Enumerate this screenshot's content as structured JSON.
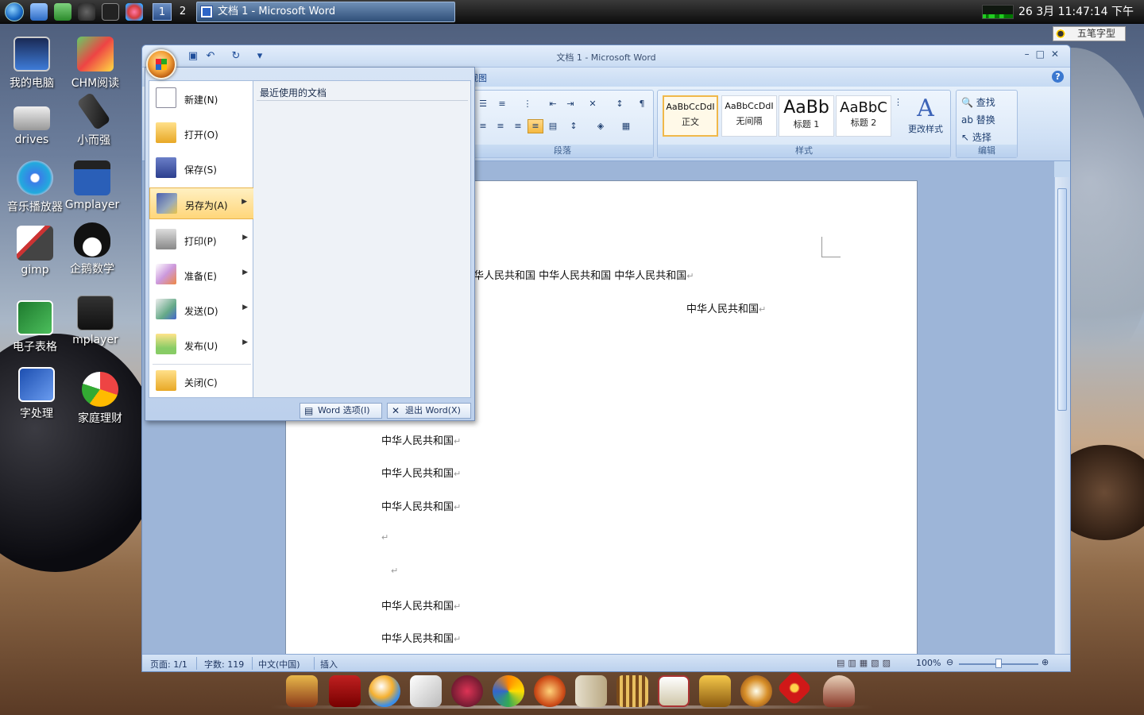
{
  "top_panel": {
    "workspaces": [
      "1",
      "2"
    ],
    "task_title": "文档 1 - Microsoft Word",
    "clock": "26  3月 11:47:14 下午",
    "ime": "五笔字型"
  },
  "desktop_icons": [
    {
      "label": "我的电脑",
      "icon": "computer-icon"
    },
    {
      "label": "CHM阅读",
      "icon": "chm-reader-icon"
    },
    {
      "label": "drives",
      "icon": "drive-icon"
    },
    {
      "label": "小而强",
      "icon": "usb-stick-icon"
    },
    {
      "label": "音乐播放器",
      "icon": "music-player-icon"
    },
    {
      "label": "Gmplayer",
      "icon": "gmplayer-icon"
    },
    {
      "label": "gimp",
      "icon": "gimp-icon"
    },
    {
      "label": "企鹅数学",
      "icon": "penguin-icon"
    },
    {
      "label": "电子表格",
      "icon": "spreadsheet-icon"
    },
    {
      "label": "mplayer",
      "icon": "mplayer-icon"
    },
    {
      "label": "字处理",
      "icon": "word-icon"
    },
    {
      "label": "家庭理财",
      "icon": "finance-icon"
    }
  ],
  "window": {
    "title": "文档 1 - Microsoft Word",
    "tab_view": "视图",
    "ribbon": {
      "paragraph_label": "段落",
      "styles_label": "样式",
      "editing_label": "编辑",
      "styles": [
        {
          "sample": "AaBbCcDdI",
          "name": "正文"
        },
        {
          "sample": "AaBbCcDdI",
          "name": "无间隔"
        },
        {
          "sample": "AaBb",
          "name": "标题 1"
        },
        {
          "sample": "AaBbC",
          "name": "标题 2"
        }
      ],
      "change_styles": "更改样式",
      "find": "查找",
      "replace": "替换",
      "select": "选择"
    },
    "document": {
      "line1": "华人民共和国    中华人民共和国    中华人民共和国",
      "line2": "中华人民共和国",
      "body_lines": [
        "中华人民共和国",
        "中华人民共和国",
        "中华人民共和国",
        "",
        "",
        "中华人民共和国",
        "中华人民共和国"
      ]
    },
    "status": {
      "page": "页面: 1/1",
      "words": "字数: 119",
      "lang": "中文(中国)",
      "mode": "插入",
      "zoom": "100%"
    }
  },
  "office_menu": {
    "recent_title": "最近使用的文档",
    "items": [
      {
        "label": "新建(N)",
        "icon": "new-document-icon",
        "submenu": false
      },
      {
        "label": "打开(O)",
        "icon": "open-folder-icon",
        "submenu": false
      },
      {
        "label": "保存(S)",
        "icon": "save-disk-icon",
        "submenu": false
      },
      {
        "label": "另存为(A)",
        "icon": "save-as-icon",
        "submenu": true
      },
      {
        "label": "打印(P)",
        "icon": "printer-icon",
        "submenu": true
      },
      {
        "label": "准备(E)",
        "icon": "prepare-icon",
        "submenu": true
      },
      {
        "label": "发送(D)",
        "icon": "send-icon",
        "submenu": true
      },
      {
        "label": "发布(U)",
        "icon": "publish-icon",
        "submenu": true
      },
      {
        "label": "关闭(C)",
        "icon": "close-folder-icon",
        "submenu": false
      }
    ],
    "options_btn": "Word 选项(I)",
    "exit_btn": "退出 Word(X)"
  },
  "dock_icons": [
    "palace-icon",
    "flag-icon",
    "globe-icon",
    "cards-icon",
    "media-icon",
    "chart-icon",
    "fire-icon",
    "notes-icon",
    "abacus-icon",
    "photo-icon",
    "chest-icon",
    "bowl-icon",
    "knot-icon",
    "teapot-icon"
  ]
}
